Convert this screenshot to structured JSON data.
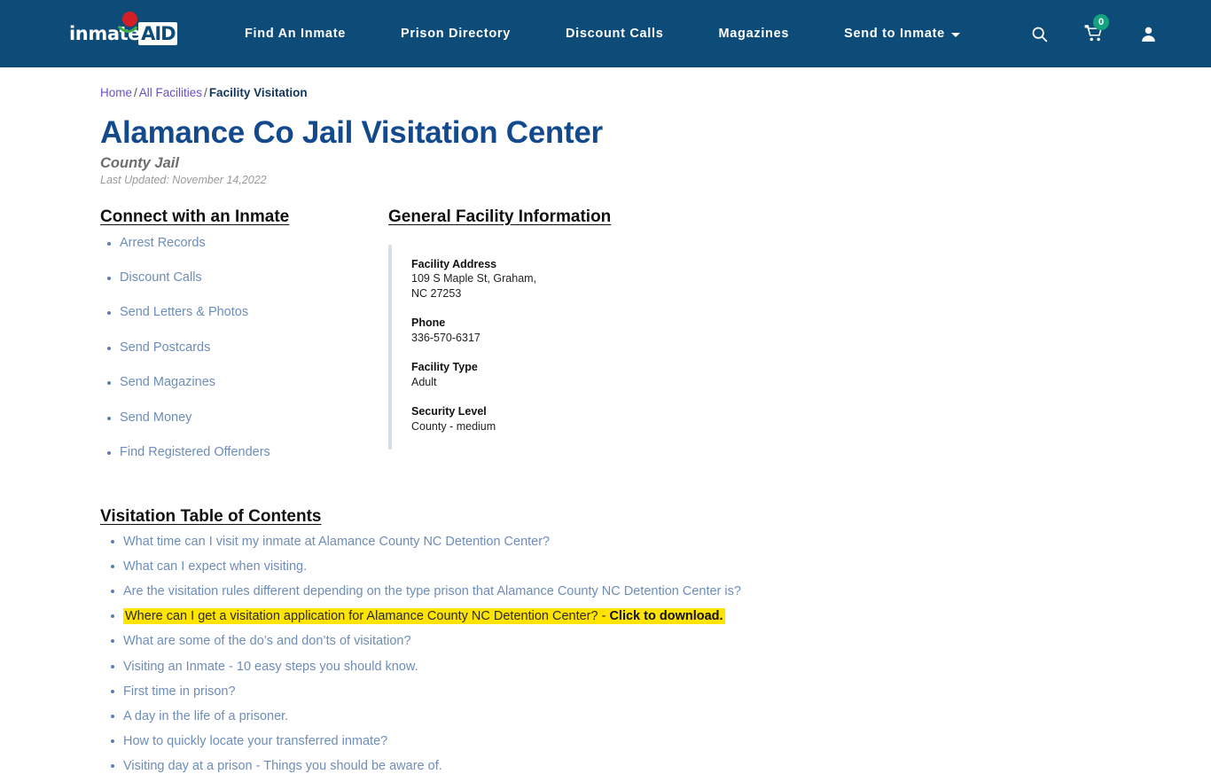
{
  "header": {
    "logo": {
      "primary": "inmate",
      "accent": "AID",
      "alt": "InmateAid logo"
    },
    "nav": [
      {
        "label": "Find An Inmate",
        "has_caret": false
      },
      {
        "label": "Prison Directory",
        "has_caret": false
      },
      {
        "label": "Discount Calls",
        "has_caret": false
      },
      {
        "label": "Magazines",
        "has_caret": false
      },
      {
        "label": "Send to Inmate",
        "has_caret": true
      }
    ],
    "icons": {
      "search": "search-icon",
      "cart": "cart-icon",
      "account": "user-account-icon"
    },
    "cart_count": "0",
    "colors": {
      "nav_background": "#0d4b79",
      "cart_badge": "#13a37f",
      "logo_dot": "#d21f26"
    }
  },
  "breadcrumb": {
    "home": "Home",
    "all_facilities": "All Facilities",
    "current": "Facility Visitation",
    "separator": "/"
  },
  "title": {
    "heading": "Alamance Co Jail Visitation Center",
    "subtitle": "County Jail",
    "last_updated": "Last Updated: November 14,2022",
    "color": "#134a8e"
  },
  "connect": {
    "heading": "Connect with an Inmate",
    "items": [
      "Arrest Records",
      "Discount Calls",
      "Send Letters & Photos",
      "Send Postcards",
      "Send Magazines",
      "Send Money",
      "Find Registered Offenders"
    ]
  },
  "facility": {
    "heading": "General Facility Information",
    "facts": [
      {
        "label": "Facility Address",
        "value": "109 S Maple St, Graham,\nNC 27253"
      },
      {
        "label": "Phone",
        "value": "336-570-6317"
      },
      {
        "label": "Facility Type",
        "value": "Adult"
      },
      {
        "label": "Security Level",
        "value": "County - medium"
      }
    ]
  },
  "toc": {
    "heading": "Visitation Table of Contents",
    "highlight_color": "#ffe400",
    "items": [
      {
        "text": "What time can I visit my inmate at Alamance County NC Detention Center?",
        "highlight": false
      },
      {
        "text": "What can I expect when visiting.",
        "highlight": false
      },
      {
        "text": "Are the visitation rules different depending on the type prison that Alamance County NC Detention Center is?",
        "highlight": false
      },
      {
        "text": "Where can I get a visitation application for Alamance County NC Detention Center? - ",
        "bold_tail": "Click to download.",
        "highlight": true
      },
      {
        "text": "What are some of the do’s and don’ts of visitation?",
        "highlight": false
      },
      {
        "text": "Visiting an Inmate - 10 easy steps you should know.",
        "highlight": false
      },
      {
        "text": "First time in prison?",
        "highlight": false
      },
      {
        "text": "A day in the life of a prisoner.",
        "highlight": false
      },
      {
        "text": "How to quickly locate your transferred inmate?",
        "highlight": false
      },
      {
        "text": "Visiting day at a prison - Things you should be aware of.",
        "highlight": false
      }
    ]
  }
}
